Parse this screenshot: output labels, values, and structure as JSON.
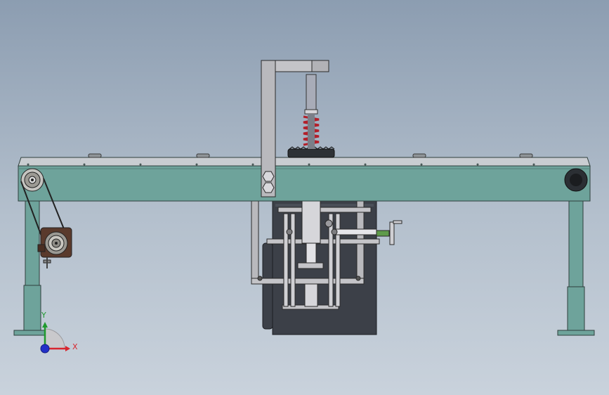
{
  "viewport": {
    "background_top": "#8c9db1",
    "background_bottom": "#c9d2dc"
  },
  "model": {
    "frame_color": "#6ea39b",
    "frame_edge_color": "#2f3f3c",
    "bracket_color": "#b9b9bd",
    "spring_color": "#b3202a",
    "housing_color": "#3c4048",
    "motor_color": "#5a3a2c"
  },
  "triad": {
    "x_label": "X",
    "y_label": "Y",
    "x_color": "#d8262e",
    "y_color": "#1f9a2e",
    "z_color": "#2230c8"
  }
}
